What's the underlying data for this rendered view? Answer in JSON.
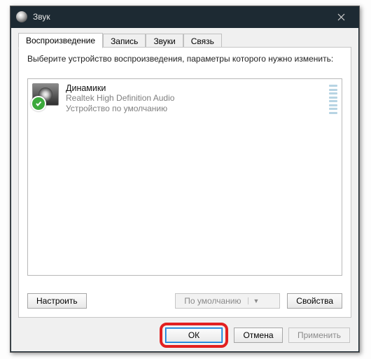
{
  "window": {
    "title": "Звук"
  },
  "tabs": {
    "playback": "Воспроизведение",
    "recording": "Запись",
    "sounds": "Звуки",
    "communications": "Связь"
  },
  "instruction": "Выберите устройство воспроизведения, параметры которого нужно изменить:",
  "device": {
    "name": "Динамики",
    "driver": "Realtek High Definition Audio",
    "status": "Устройство по умолчанию"
  },
  "buttons": {
    "configure": "Настроить",
    "set_default": "По умолчанию",
    "properties": "Свойства",
    "ok": "ОК",
    "cancel": "Отмена",
    "apply": "Применить"
  }
}
